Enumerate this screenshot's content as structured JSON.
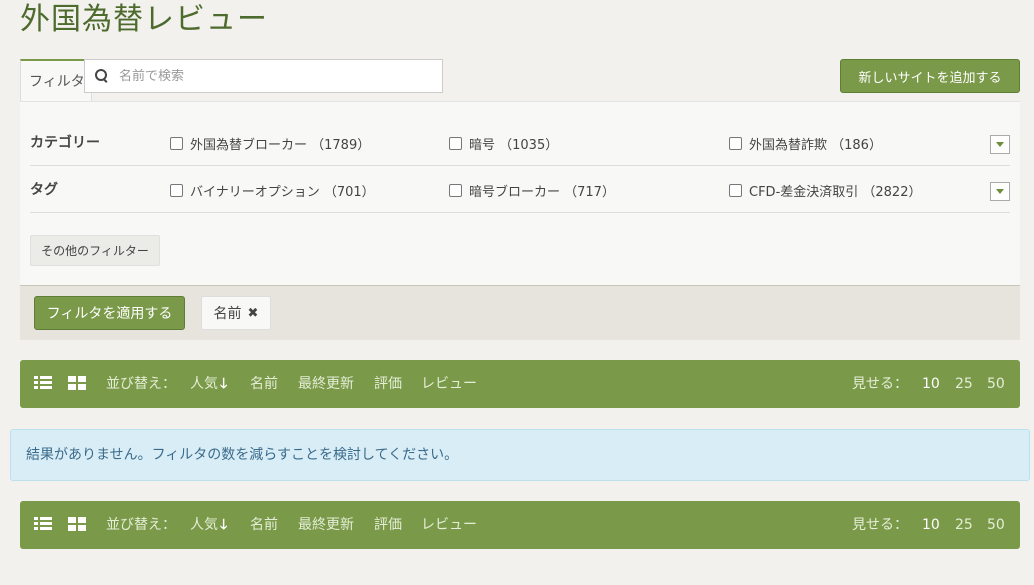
{
  "page": {
    "title": "外国為替レビュー"
  },
  "filter_tab": {
    "label": "フィルタ"
  },
  "search": {
    "placeholder": "名前で検索",
    "value": ""
  },
  "add_site_button": {
    "label": "新しいサイトを追加する"
  },
  "filters": {
    "rows": [
      {
        "label": "カテゴリー",
        "options": [
          {
            "label": "外国為替ブローカー （1789）",
            "checked": false
          },
          {
            "label": "暗号 （1035）",
            "checked": false
          },
          {
            "label": "外国為替詐欺 （186）",
            "checked": false
          }
        ]
      },
      {
        "label": "タグ",
        "options": [
          {
            "label": "バイナリーオプション （701）",
            "checked": false
          },
          {
            "label": "暗号ブローカー （717）",
            "checked": false
          },
          {
            "label": "CFD-差金決済取引 （2822）",
            "checked": false
          }
        ]
      }
    ],
    "more_filters_label": "その他のフィルター"
  },
  "apply_bar": {
    "apply_label": "フィルタを適用する",
    "chip_label": "名前"
  },
  "toolbar": {
    "sort_label": "並び替え：",
    "sort_options": [
      "人気",
      "名前",
      "最終更新",
      "評価",
      "レビュー"
    ],
    "show_label": "見せる：",
    "page_sizes": [
      "10",
      "25",
      "50"
    ],
    "active_page_size": "10",
    "active_sort": "人気"
  },
  "alert": {
    "message": "結果がありません。フィルタの数を減らすことを検討してください。"
  },
  "colors": {
    "accent": "#7a9a4a",
    "title": "#4e6b2e",
    "alert_bg": "#d9edf7"
  }
}
